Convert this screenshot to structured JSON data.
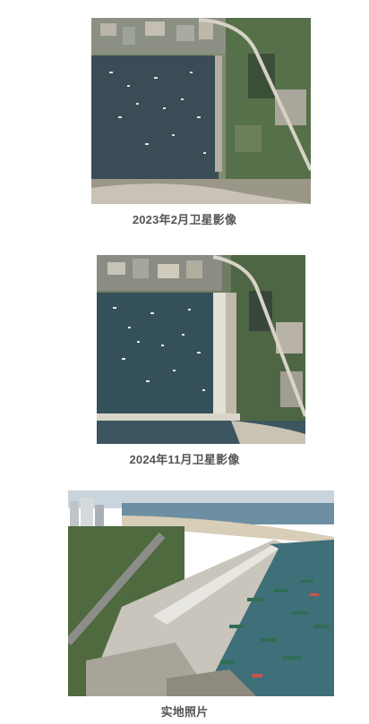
{
  "figures": [
    {
      "id": "satellite-2023-02",
      "caption": "2023年2月卫星影像"
    },
    {
      "id": "satellite-2024-11",
      "caption": "2024年11月卫星影像"
    },
    {
      "id": "site-photo",
      "caption": "实地照片"
    }
  ]
}
